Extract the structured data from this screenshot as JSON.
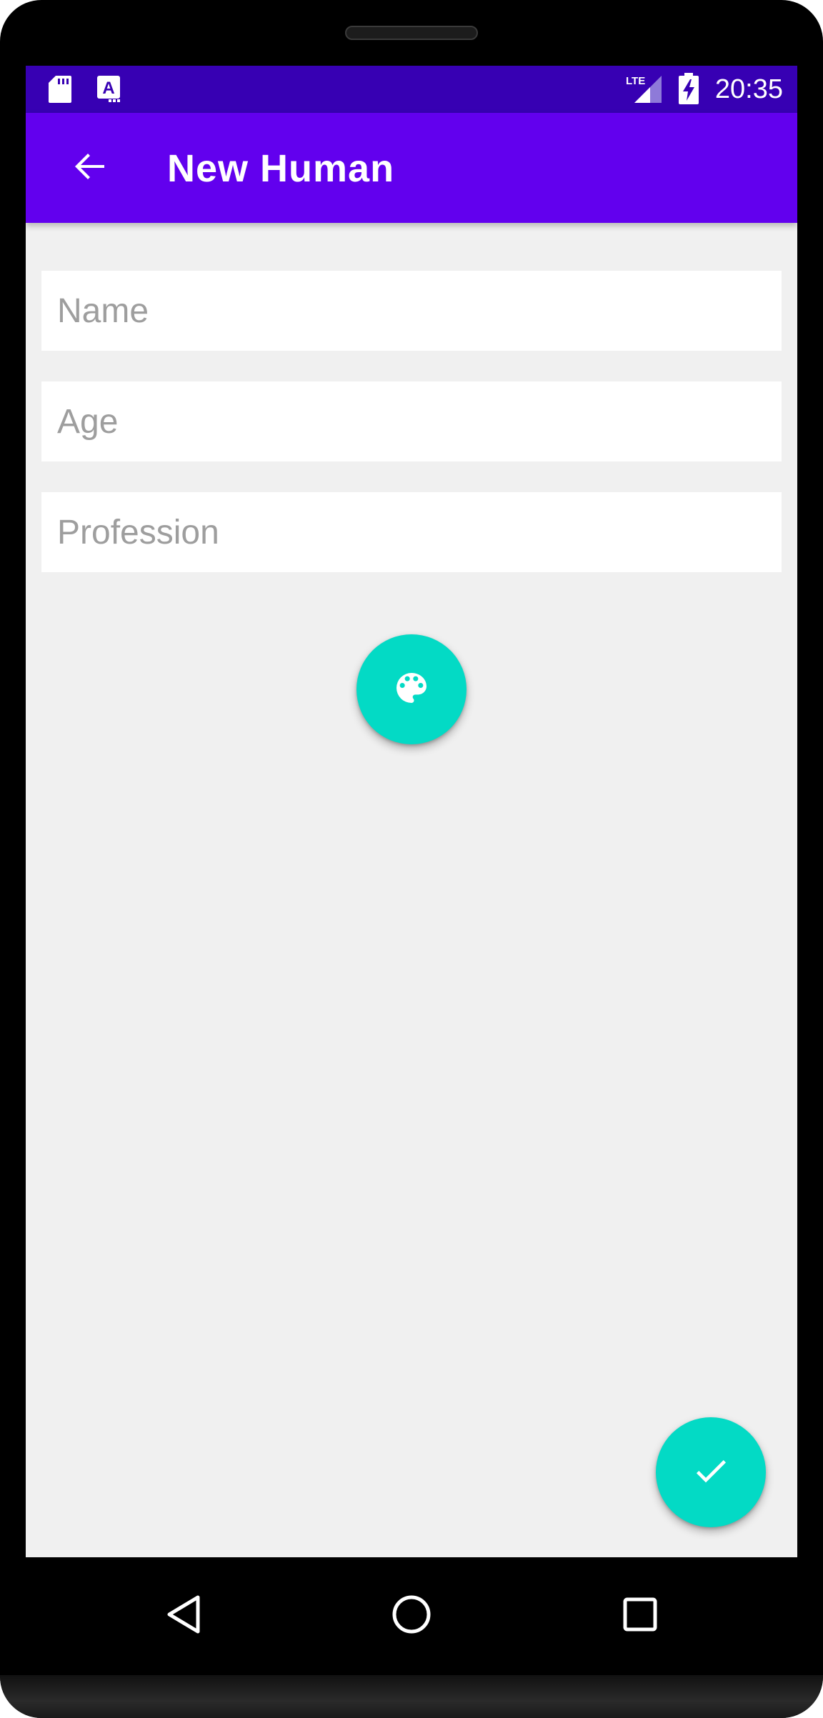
{
  "status_bar": {
    "time": "20:35",
    "network_label": "LTE",
    "icons": [
      "sd-card-icon",
      "text-a-icon",
      "lte-signal-icon",
      "battery-charging-icon"
    ]
  },
  "app_bar": {
    "title": "New Human",
    "back_icon": "arrow-back-icon"
  },
  "form": {
    "name_placeholder": "Name",
    "name_value": "",
    "age_placeholder": "Age",
    "age_value": "",
    "profession_placeholder": "Profession",
    "profession_value": ""
  },
  "actions": {
    "color_icon": "palette-icon",
    "save_icon": "check-icon"
  },
  "nav_bar": {
    "icons": [
      "back-triangle-icon",
      "home-circle-icon",
      "recents-square-icon"
    ]
  },
  "colors": {
    "status_bar": "#3700b3",
    "app_bar": "#6200ee",
    "accent": "#03dac5",
    "background": "#f0f0f0"
  }
}
